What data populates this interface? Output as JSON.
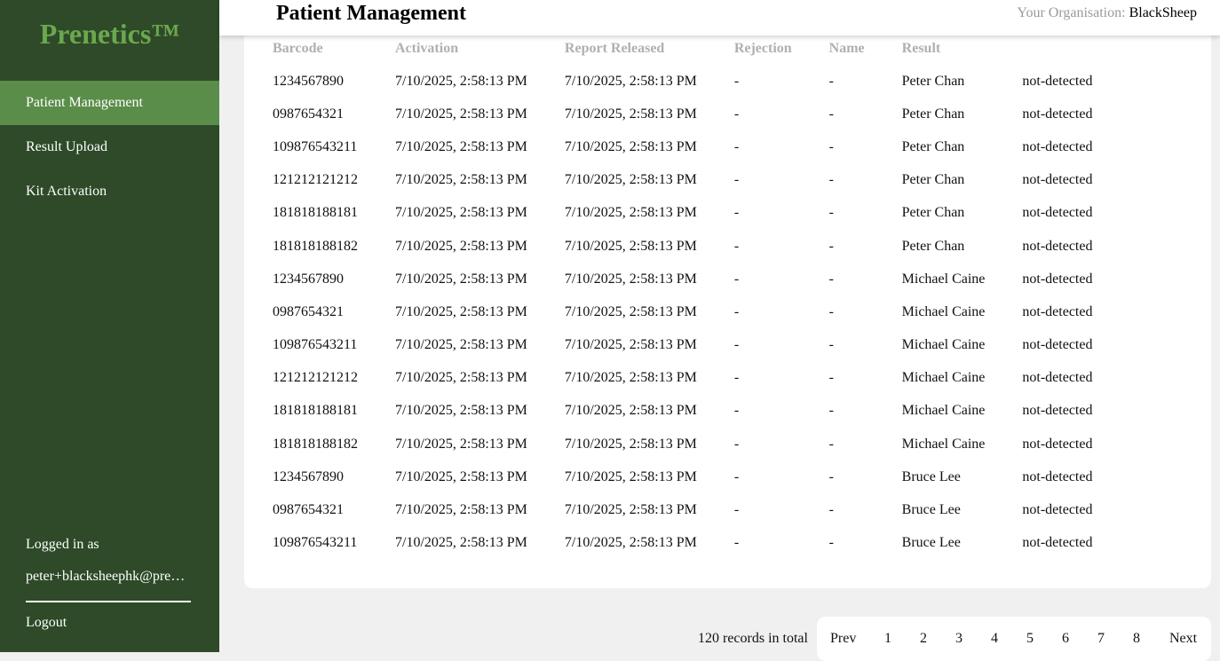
{
  "sidebar": {
    "logo": "Prenetics™",
    "items": [
      {
        "label": "Patient Management"
      },
      {
        "label": "Result Upload"
      },
      {
        "label": "Kit Activation"
      }
    ],
    "logged_in_label": "Logged in as",
    "logged_in_email": "peter+blacksheephk@prenetics.com",
    "logout_label": "Logout"
  },
  "header": {
    "title": "Patient Management",
    "org_label": "Your Organisation:",
    "org_value": "BlackSheep"
  },
  "table": {
    "columns": [
      "Barcode",
      "Activation",
      "Report Released",
      "Rejection",
      "Name",
      "Result",
      ""
    ],
    "rows": [
      [
        "1234567890",
        "7/10/2025, 2:58:13 PM",
        "7/10/2025, 2:58:13 PM",
        "-",
        "-",
        "Peter Chan",
        "not-detected"
      ],
      [
        "0987654321",
        "7/10/2025, 2:58:13 PM",
        "7/10/2025, 2:58:13 PM",
        "-",
        "-",
        "Peter Chan",
        "not-detected"
      ],
      [
        "109876543211",
        "7/10/2025, 2:58:13 PM",
        "7/10/2025, 2:58:13 PM",
        "-",
        "-",
        "Peter Chan",
        "not-detected"
      ],
      [
        "121212121212",
        "7/10/2025, 2:58:13 PM",
        "7/10/2025, 2:58:13 PM",
        "-",
        "-",
        "Peter Chan",
        "not-detected"
      ],
      [
        "181818188181",
        "7/10/2025, 2:58:13 PM",
        "7/10/2025, 2:58:13 PM",
        "-",
        "-",
        "Peter Chan",
        "not-detected"
      ],
      [
        "181818188182",
        "7/10/2025, 2:58:13 PM",
        "7/10/2025, 2:58:13 PM",
        "-",
        "-",
        "Peter Chan",
        "not-detected"
      ],
      [
        "1234567890",
        "7/10/2025, 2:58:13 PM",
        "7/10/2025, 2:58:13 PM",
        "-",
        "-",
        "Michael Caine",
        "not-detected"
      ],
      [
        "0987654321",
        "7/10/2025, 2:58:13 PM",
        "7/10/2025, 2:58:13 PM",
        "-",
        "-",
        "Michael Caine",
        "not-detected"
      ],
      [
        "109876543211",
        "7/10/2025, 2:58:13 PM",
        "7/10/2025, 2:58:13 PM",
        "-",
        "-",
        "Michael Caine",
        "not-detected"
      ],
      [
        "121212121212",
        "7/10/2025, 2:58:13 PM",
        "7/10/2025, 2:58:13 PM",
        "-",
        "-",
        "Michael Caine",
        "not-detected"
      ],
      [
        "181818188181",
        "7/10/2025, 2:58:13 PM",
        "7/10/2025, 2:58:13 PM",
        "-",
        "-",
        "Michael Caine",
        "not-detected"
      ],
      [
        "181818188182",
        "7/10/2025, 2:58:13 PM",
        "7/10/2025, 2:58:13 PM",
        "-",
        "-",
        "Michael Caine",
        "not-detected"
      ],
      [
        "1234567890",
        "7/10/2025, 2:58:13 PM",
        "7/10/2025, 2:58:13 PM",
        "-",
        "-",
        "Bruce Lee",
        "not-detected"
      ],
      [
        "0987654321",
        "7/10/2025, 2:58:13 PM",
        "7/10/2025, 2:58:13 PM",
        "-",
        "-",
        "Bruce Lee",
        "not-detected"
      ],
      [
        "109876543211",
        "7/10/2025, 2:58:13 PM",
        "7/10/2025, 2:58:13 PM",
        "-",
        "-",
        "Bruce Lee",
        "not-detected"
      ]
    ]
  },
  "pagination": {
    "records_text": "120 records in total",
    "prev_label": "Prev",
    "pages": [
      "1",
      "2",
      "3",
      "4",
      "5",
      "6",
      "7",
      "8"
    ],
    "next_label": "Next"
  },
  "colors": {
    "sidebar_bg": "#2e4a28",
    "active_item_bg": "#5a8d4a",
    "logo": "#6aa84f"
  }
}
